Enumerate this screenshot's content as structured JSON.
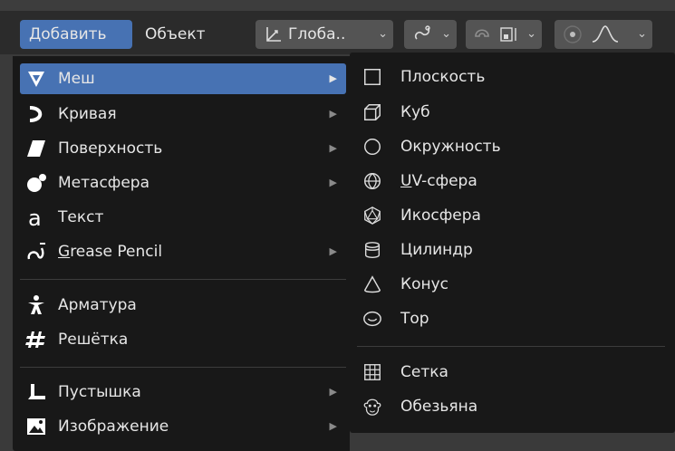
{
  "header": {
    "add_label": "Добавить",
    "object_label": "Объект",
    "orientation_label": "Глоба..",
    "dropdown_arrow": "⌄"
  },
  "add_menu": {
    "items": [
      {
        "label": "Меш",
        "icon": "mesh-icon",
        "has_submenu": true
      },
      {
        "label": "Кривая",
        "icon": "curve-icon",
        "has_submenu": true
      },
      {
        "label": "Поверхность",
        "icon": "surface-icon",
        "has_submenu": true
      },
      {
        "label": "Метасфера",
        "icon": "metaball-icon",
        "has_submenu": true
      },
      {
        "label": "Текст",
        "icon": "text-icon",
        "has_submenu": false
      },
      {
        "label_rest": "rease Pencil",
        "label_first": "G",
        "icon": "grease-pencil-icon",
        "has_submenu": true
      },
      {
        "label": "Арматура",
        "icon": "armature-icon",
        "has_submenu": false
      },
      {
        "label": "Решётка",
        "icon": "lattice-icon",
        "has_submenu": false
      },
      {
        "label": "Пустышка",
        "icon": "empty-icon",
        "has_submenu": true
      },
      {
        "label": "Изображение",
        "icon": "image-icon",
        "has_submenu": true
      }
    ],
    "submenu_arrow": "▶"
  },
  "mesh_submenu": {
    "items": [
      {
        "label": "Плоскость",
        "icon": "plane-icon"
      },
      {
        "label": "Куб",
        "icon": "cube-icon"
      },
      {
        "label": "Окружность",
        "icon": "circle-icon"
      },
      {
        "label_first": "U",
        "label_rest": "V-сфера",
        "icon": "uv-sphere-icon"
      },
      {
        "label": "Икосфера",
        "icon": "icosphere-icon"
      },
      {
        "label": "Цилиндр",
        "icon": "cylinder-icon"
      },
      {
        "label": "Конус",
        "icon": "cone-icon"
      },
      {
        "label": "Тор",
        "icon": "torus-icon"
      },
      {
        "label": "Сетка",
        "icon": "grid-icon"
      },
      {
        "label": "Обезьяна",
        "icon": "monkey-icon"
      }
    ]
  },
  "colors": {
    "accent": "#4772b3",
    "menu_bg": "#181818",
    "header_bg": "#2b2b2b"
  }
}
